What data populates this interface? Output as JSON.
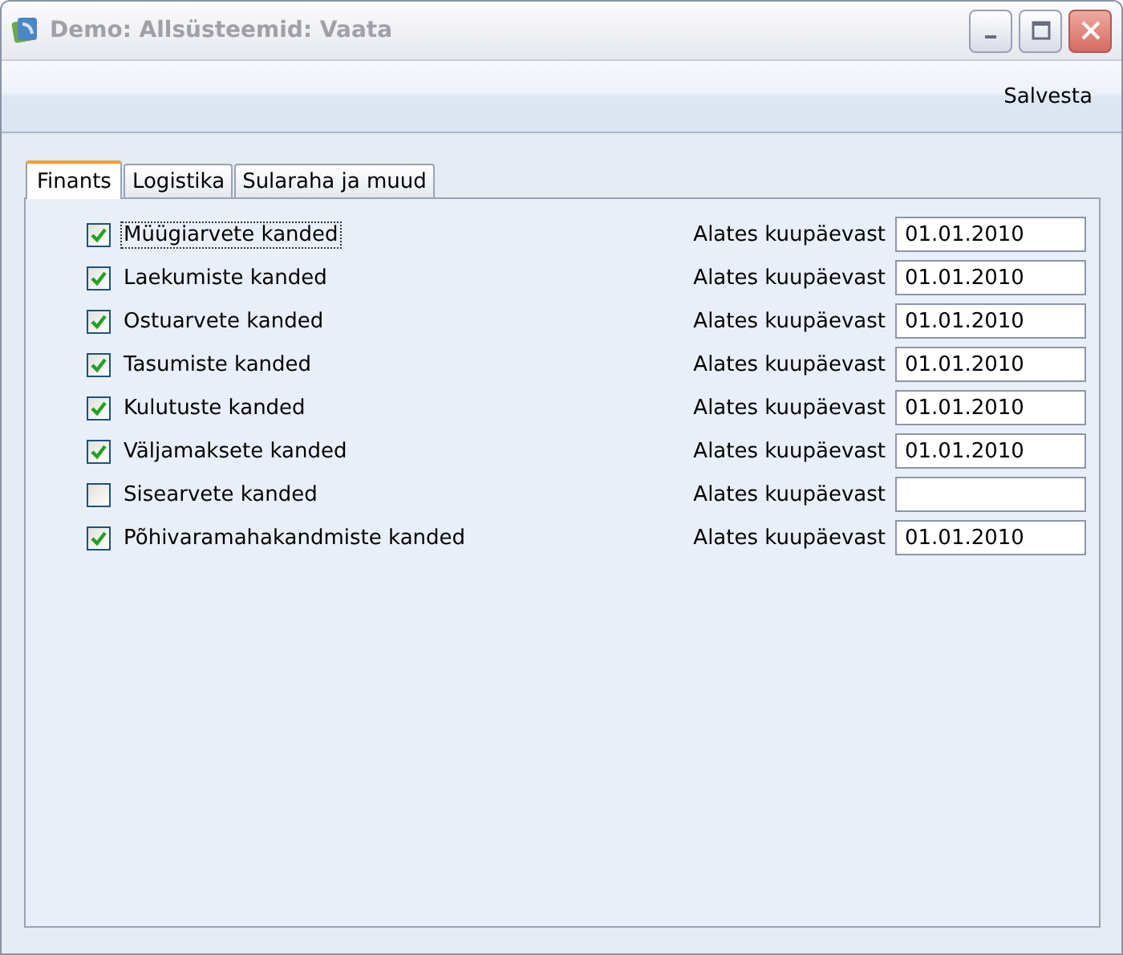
{
  "window": {
    "title": "Demo: Allsüsteemid: Vaata"
  },
  "toolbar": {
    "save": "Salvesta"
  },
  "tabs": [
    {
      "label": "Finants",
      "selected": true
    },
    {
      "label": "Logistika",
      "selected": false
    },
    {
      "label": "Sularaha ja muud",
      "selected": false
    }
  ],
  "rows": [
    {
      "label": "Müügiarvete kanded",
      "checked": true,
      "focused": true,
      "date_label": "Alates kuupäevast",
      "value": "01.01.2010"
    },
    {
      "label": "Laekumiste kanded",
      "checked": true,
      "focused": false,
      "date_label": "Alates kuupäevast",
      "value": "01.01.2010"
    },
    {
      "label": "Ostuarvete kanded",
      "checked": true,
      "focused": false,
      "date_label": "Alates kuupäevast",
      "value": "01.01.2010"
    },
    {
      "label": "Tasumiste kanded",
      "checked": true,
      "focused": false,
      "date_label": "Alates kuupäevast",
      "value": "01.01.2010"
    },
    {
      "label": "Kulutuste kanded",
      "checked": true,
      "focused": false,
      "date_label": "Alates kuupäevast",
      "value": "01.01.2010"
    },
    {
      "label": "Väljamaksete kanded",
      "checked": true,
      "focused": false,
      "date_label": "Alates kuupäevast",
      "value": "01.01.2010"
    },
    {
      "label": "Sisearvete kanded",
      "checked": false,
      "focused": false,
      "date_label": "Alates kuupäevast"
    },
    {
      "label": "Põhivaramahakandmiste kanded",
      "checked": true,
      "focused": false,
      "date_label": "Alates kuupäevast",
      "value": "01.01.2010"
    }
  ]
}
